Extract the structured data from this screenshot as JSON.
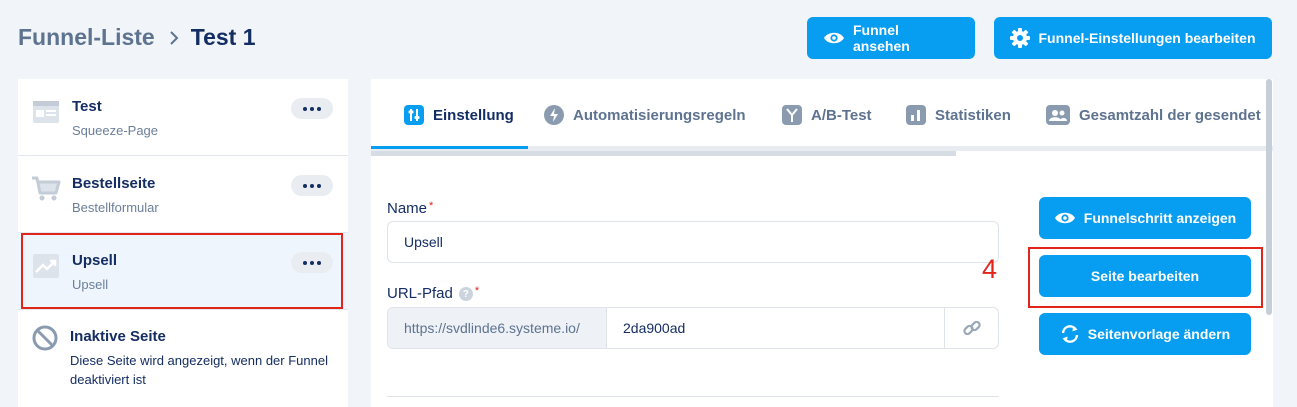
{
  "breadcrumb": {
    "parent": "Funnel-Liste",
    "current": "Test 1"
  },
  "header": {
    "view_funnel": "Funnel ansehen",
    "edit_settings": "Funnel-Einstellungen bearbeiten"
  },
  "sidebar": {
    "items": [
      {
        "title": "Test",
        "subtitle": "Squeeze-Page",
        "icon": "page-layout-icon"
      },
      {
        "title": "Bestellseite",
        "subtitle": "Bestellformular",
        "icon": "cart-icon"
      },
      {
        "title": "Upsell",
        "subtitle": "Upsell",
        "icon": "trend-icon"
      }
    ],
    "inactive": {
      "title": "Inaktive Seite",
      "description": "Diese Seite wird angezeigt, wenn der Funnel deaktiviert ist"
    }
  },
  "tabs": [
    {
      "label": "Einstellung",
      "icon": "sliders-icon"
    },
    {
      "label": "Automatisierungsregeln",
      "icon": "bolt-icon"
    },
    {
      "label": "A/B-Test",
      "icon": "split-icon"
    },
    {
      "label": "Statistiken",
      "icon": "bar-chart-icon"
    },
    {
      "label": "Gesamtzahl der gesendet",
      "icon": "users-icon"
    }
  ],
  "form": {
    "name_label": "Name",
    "name_value": "Upsell",
    "url_label": "URL-Pfad",
    "url_prefix": "https://svdlinde6.systeme.io/",
    "url_value": "2da900ad",
    "required_mark": "*",
    "help_mark": "?"
  },
  "actions": {
    "show_step": "Funnelschritt anzeigen",
    "edit_page": "Seite bearbeiten",
    "change_template": "Seitenvorlage ändern"
  },
  "annotation": {
    "number": "4"
  },
  "colors": {
    "accent": "#079df0",
    "annotation": "#e1251b",
    "text": "#142d63"
  }
}
